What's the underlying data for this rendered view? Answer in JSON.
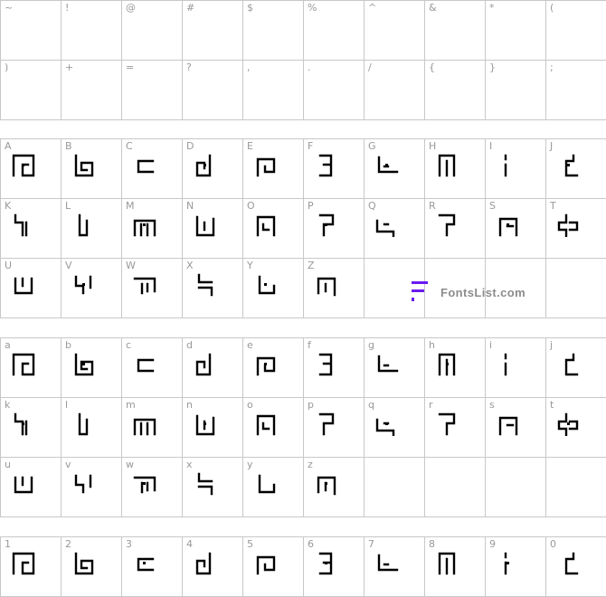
{
  "sections": [
    {
      "key": "symbols",
      "rows": [
        [
          "~",
          "!",
          "@",
          "#",
          "$",
          "%",
          "^",
          "&",
          "*",
          "("
        ],
        [
          ")",
          "+",
          "=",
          "?",
          ",",
          ".",
          "/",
          "{",
          "}",
          ";"
        ]
      ],
      "show_glyph": false
    },
    {
      "key": "upper",
      "rows": [
        [
          "A",
          "B",
          "C",
          "D",
          "E",
          "F",
          "G",
          "H",
          "I",
          "J"
        ],
        [
          "K",
          "L",
          "M",
          "N",
          "O",
          "P",
          "Q",
          "R",
          "S",
          "T"
        ],
        [
          "U",
          "V",
          "W",
          "X",
          "Y",
          "Z",
          "",
          "",
          "",
          ""
        ]
      ],
      "show_glyph": true
    },
    {
      "key": "lower",
      "rows": [
        [
          "a",
          "b",
          "c",
          "d",
          "e",
          "f",
          "g",
          "h",
          "i",
          "j"
        ],
        [
          "k",
          "l",
          "m",
          "n",
          "o",
          "p",
          "q",
          "r",
          "s",
          "t"
        ],
        [
          "u",
          "v",
          "w",
          "x",
          "y",
          "z",
          "",
          "",
          "",
          ""
        ]
      ],
      "show_glyph": true
    },
    {
      "key": "digits",
      "rows": [
        [
          "1",
          "2",
          "3",
          "4",
          "5",
          "6",
          "7",
          "8",
          "9",
          "0"
        ]
      ],
      "show_glyph": true
    }
  ],
  "watermark": {
    "text": "FontsList.com",
    "color": "#6a1bf0"
  }
}
